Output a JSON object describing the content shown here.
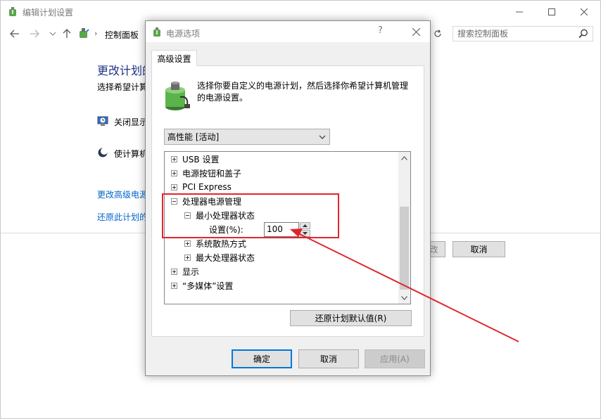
{
  "background_window": {
    "title": "编辑计划设置",
    "address_crumb": "控制面板",
    "search_placeholder": "搜索控制面板",
    "heading": "更改计划的",
    "subheading": "选择希望计算",
    "rows": [
      {
        "label": "关闭显示",
        "icon": "monitor-clock-icon"
      },
      {
        "label": "使计算机",
        "icon": "moon-sleep-icon"
      }
    ],
    "links": [
      "更改高级电源",
      "还原此计划的"
    ],
    "buttons": {
      "save_partial": "改",
      "cancel": "取消"
    }
  },
  "dialog": {
    "title": "电源选项",
    "help": "?",
    "tab": "高级设置",
    "description": "选择你要自定义的电源计划，然后选择你希望计算机管理的电源设置。",
    "plan_selected": "高性能 [活动]",
    "tree": [
      {
        "label": "USB 设置",
        "state": "collapsed",
        "level": 0
      },
      {
        "label": "电源按钮和盖子",
        "state": "collapsed",
        "level": 0
      },
      {
        "label": "PCI Express",
        "state": "collapsed",
        "level": 0
      },
      {
        "label": "处理器电源管理",
        "state": "expanded",
        "level": 0
      },
      {
        "label": "最小处理器状态",
        "state": "expanded",
        "level": 1
      },
      {
        "label": "设置(%):",
        "state": "value",
        "level": 2
      },
      {
        "label": "系统散热方式",
        "state": "collapsed",
        "level": 1
      },
      {
        "label": "最大处理器状态",
        "state": "collapsed",
        "level": 1
      },
      {
        "label": "显示",
        "state": "collapsed",
        "level": 0
      },
      {
        "label": "“多媒体”设置",
        "state": "collapsed",
        "level": 0
      }
    ],
    "setting_value": "100",
    "restore_defaults": "还原计划默认值(R)",
    "ok": "确定",
    "cancel": "取消",
    "apply": "应用(A)"
  },
  "colors": {
    "annotation": "#e0262b",
    "link": "#0066cc",
    "heading": "#1e3287"
  }
}
